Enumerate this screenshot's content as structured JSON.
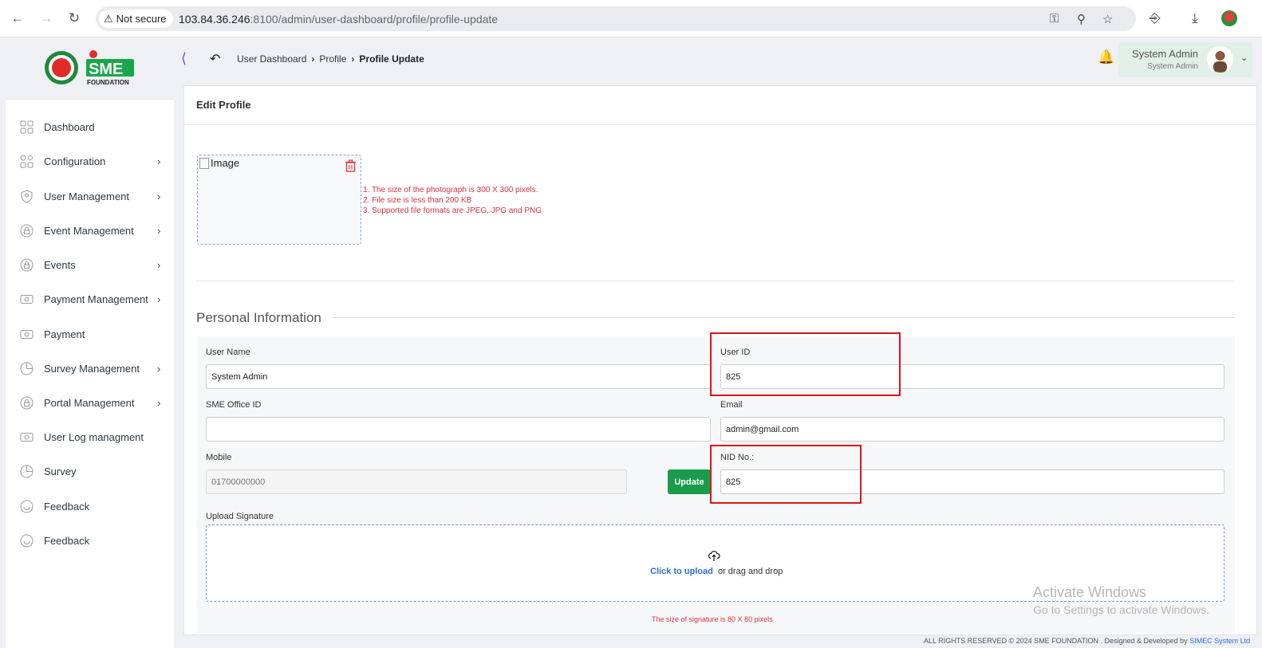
{
  "browser": {
    "security_label": "Not secure",
    "url_host": "103.84.36.246",
    "url_rest": ":8100/admin/user-dashboard/profile/profile-update"
  },
  "brand": {
    "logo_text": "SME",
    "logo_sub": "FOUNDATION"
  },
  "sidebar": {
    "items": [
      {
        "label": "Dashboard",
        "icon": "grid-icon",
        "expandable": false
      },
      {
        "label": "Configuration",
        "icon": "config-icon",
        "expandable": true
      },
      {
        "label": "User Management",
        "icon": "user-shield-icon",
        "expandable": true
      },
      {
        "label": "Event Management",
        "icon": "lock-icon",
        "expandable": true
      },
      {
        "label": "Events",
        "icon": "lock-icon",
        "expandable": true
      },
      {
        "label": "Payment Management",
        "icon": "money-icon",
        "expandable": true
      },
      {
        "label": "Payment",
        "icon": "money-icon",
        "expandable": false
      },
      {
        "label": "Survey Management",
        "icon": "pie-icon",
        "expandable": true
      },
      {
        "label": "Portal Management",
        "icon": "lock-icon",
        "expandable": true
      },
      {
        "label": "User Log managment",
        "icon": "money-icon",
        "expandable": false
      },
      {
        "label": "Survey",
        "icon": "pie-icon",
        "expandable": false
      },
      {
        "label": "Feedback",
        "icon": "feedback-icon",
        "expandable": false
      },
      {
        "label": "Feedback",
        "icon": "feedback-icon",
        "expandable": false
      }
    ]
  },
  "header": {
    "breadcrumb": [
      "User Dashboard",
      "Profile",
      "Profile Update"
    ],
    "user_name": "System Admin",
    "user_role": "System Admin"
  },
  "card": {
    "title": "Edit Profile",
    "image_alt": "Image",
    "image_notes": [
      "1. The size of the photograph is 300 X 300 pixels.",
      "2. File size is less than 200 KB",
      "3. Supported file formats are JPEG, JPG and PNG"
    ],
    "section_title": "Personal Information"
  },
  "form": {
    "user_name": {
      "label": "User Name",
      "value": "System Admin"
    },
    "user_id": {
      "label": "User ID",
      "value": "825"
    },
    "sme_office_id": {
      "label": "SME Office ID",
      "value": ""
    },
    "email": {
      "label": "Email",
      "value": "admin@gmail.com"
    },
    "mobile": {
      "label": "Mobile",
      "placeholder": "01700000000"
    },
    "update_label": "Update",
    "nid": {
      "label": "NID No.:",
      "value": "825"
    },
    "signature_label": "Upload Signature",
    "upload_link": "Click to upload",
    "upload_rest": "or drag and drop",
    "signature_note": "The size of signature is 80 X 80 pixels"
  },
  "overlay": {
    "watermark_title": "Activate Windows",
    "watermark_sub": "Go to Settings to activate Windows."
  },
  "footer": {
    "text": "ALL RIGHTS RESERVED © 2024 SME FOUNDATION . Designed & Developed by",
    "link": "SIMEC System Ltd"
  },
  "colors": {
    "accent_green": "#1a9c4b",
    "highlight_red": "#e0131a",
    "note_red": "#d9333f",
    "link_blue": "#2f6fd6"
  }
}
